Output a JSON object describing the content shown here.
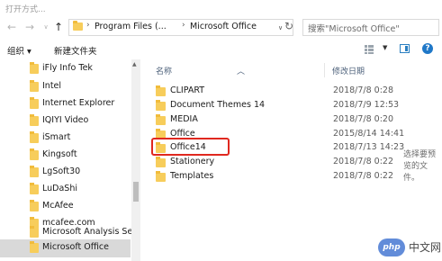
{
  "window": {
    "title": "打开方式..."
  },
  "nav": {
    "crumbs": [
      "Program Files (...",
      "Microsoft Office"
    ],
    "search_placeholder": "搜索\"Microsoft Office\""
  },
  "toolbar": {
    "organize": "组织 ▾",
    "new_folder": "新建文件夹"
  },
  "sidebar": {
    "items": [
      "iFly Info Tek",
      "Intel",
      "Internet Explorer",
      "IQIYI Video",
      "iSmart",
      "Kingsoft",
      "LgSoft30",
      "LuDaShi",
      "McAfee",
      "mcafee.com",
      "Microsoft Analysis Ser",
      "Microsoft Office"
    ],
    "selected": "Microsoft Office"
  },
  "columns": {
    "name": "名称",
    "date": "修改日期"
  },
  "files": [
    {
      "name": "CLIPART",
      "date": "2018/7/8 0:28"
    },
    {
      "name": "Document Themes 14",
      "date": "2018/7/9 12:53"
    },
    {
      "name": "MEDIA",
      "date": "2018/7/8 0:20"
    },
    {
      "name": "Office",
      "date": "2015/8/14 14:41"
    },
    {
      "name": "Office14",
      "date": "2018/7/13 14:23"
    },
    {
      "name": "Stationery",
      "date": "2018/7/8 0:22"
    },
    {
      "name": "Templates",
      "date": "2018/7/8 0:22"
    }
  ],
  "preview": {
    "text": "选择要预览的文件。"
  },
  "watermark": {
    "logo": "php",
    "text": "中文网"
  },
  "colors": {
    "highlight": "#e0281f",
    "folder": "#f7cd5b",
    "selected_bg": "#d9d9d9",
    "accent": "#1f78c8"
  }
}
